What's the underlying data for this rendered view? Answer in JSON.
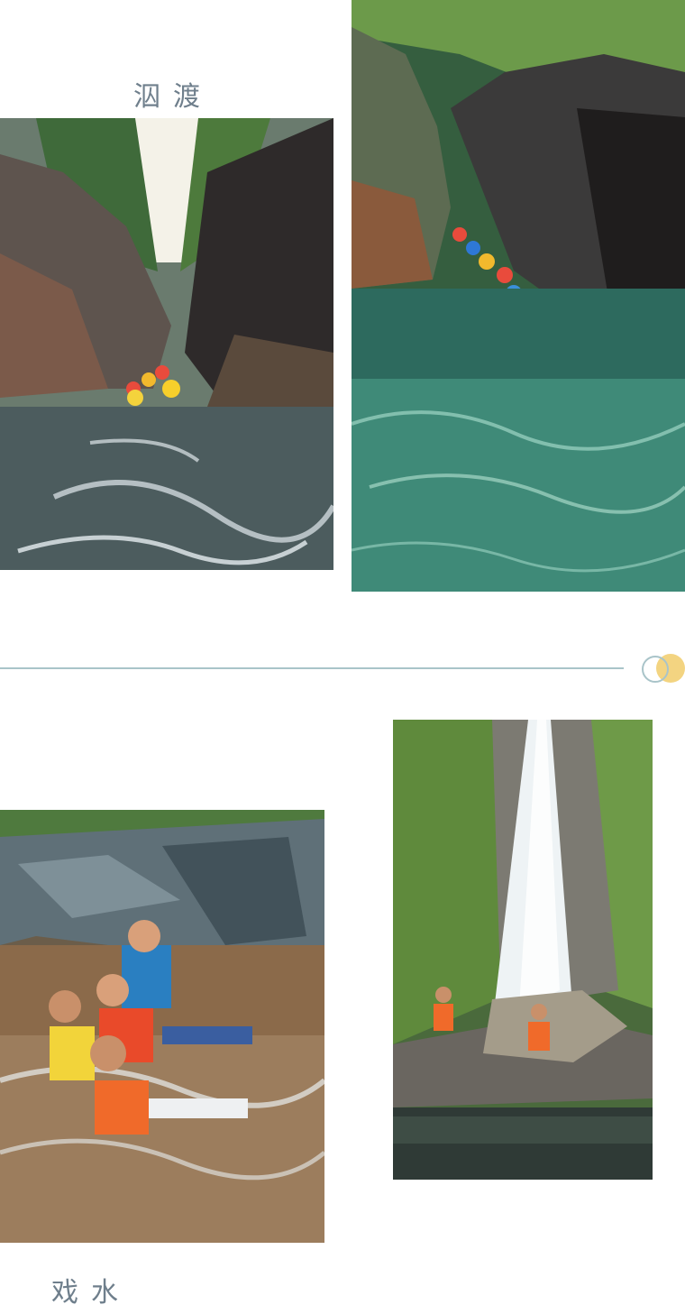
{
  "sections": [
    {
      "caption": "泅渡"
    },
    {
      "caption": "戏水"
    }
  ],
  "photos": [
    {
      "subject": "group-swimming-in-canyon-pool",
      "icon": "photo-canyon-swim"
    },
    {
      "subject": "swimmers-in-green-canyon-water",
      "icon": "photo-canyon-wide"
    },
    {
      "subject": "children-playing-in-stream",
      "icon": "photo-kids-water"
    },
    {
      "subject": "waterfall-with-hikers",
      "icon": "photo-waterfall"
    }
  ],
  "colors": {
    "caption": "#6f7f8c",
    "divider": "#a9c4c9",
    "accent_dot": "#f2d27a"
  }
}
